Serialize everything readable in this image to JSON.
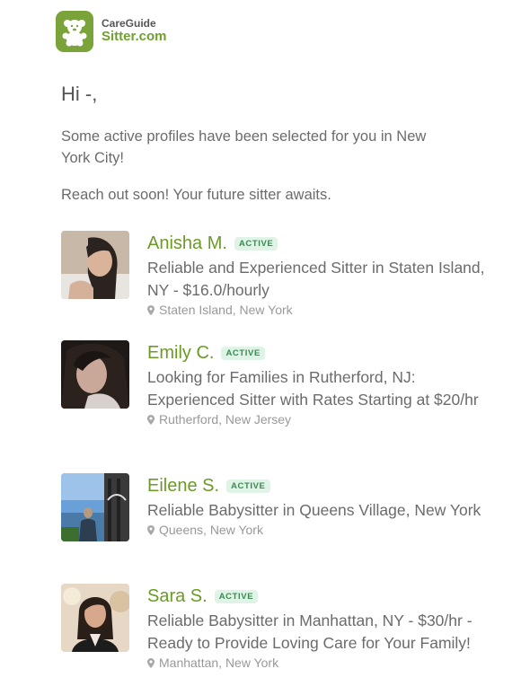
{
  "brand": {
    "line1": "CareGuide",
    "line2": "Sitter.com",
    "accent": "#7aa33a"
  },
  "greeting": "Hi -,",
  "intro": "Some active profiles have been selected for you in New York City!",
  "reach_out": "Reach out soon! Your future sitter awaits.",
  "profiles": [
    {
      "name": "Anisha M.",
      "badge": "ACTIVE",
      "description": "Reliable and Experienced Sitter in Staten Island, NY - $16.0/hourly",
      "location": "Staten Island, New York"
    },
    {
      "name": "Emily C.",
      "badge": "ACTIVE",
      "description": "Looking for Families in Rutherford, NJ: Experienced Sitter with Rates Starting at $20/hr",
      "location": "Rutherford, New Jersey"
    },
    {
      "name": "Eilene S.",
      "badge": "ACTIVE",
      "description": "Reliable Babysitter in Queens Village, New York",
      "location": "Queens, New York"
    },
    {
      "name": "Sara S.",
      "badge": "ACTIVE",
      "description": "Reliable Babysitter in Manhattan, NY - $30/hr - Ready to Provide Loving Care for Your Family!",
      "location": "Manhattan, New York"
    }
  ]
}
